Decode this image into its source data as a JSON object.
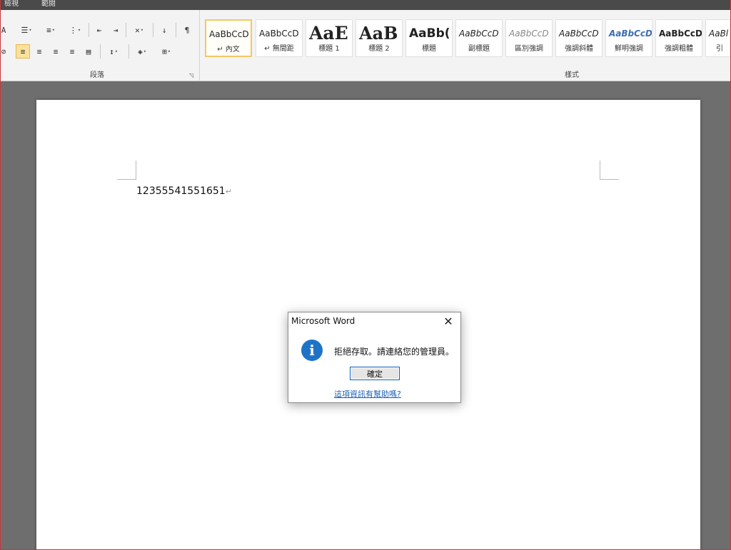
{
  "menu": {
    "items": [
      "檢視",
      "範閱"
    ]
  },
  "ribbon": {
    "paragraph_group_label": "段落",
    "styles_group_label": "樣式",
    "styles": [
      {
        "preview": "AaBbCcD",
        "name": "↵ 內文"
      },
      {
        "preview": "AaBbCcD",
        "name": "↵ 無間距"
      },
      {
        "preview": "AaE",
        "name": "標題 1"
      },
      {
        "preview": "AaB",
        "name": "標題 2"
      },
      {
        "preview": "AaBb(",
        "name": "標題"
      },
      {
        "preview": "AaBbCcD",
        "name": "副標題"
      },
      {
        "preview": "AaBbCcD",
        "name": "區別強調"
      },
      {
        "preview": "AaBbCcD",
        "name": "強調斜體"
      },
      {
        "preview": "AaBbCcD",
        "name": "鮮明強調"
      },
      {
        "preview": "AaBbCcD",
        "name": "強調粗體"
      },
      {
        "preview": "AaBl",
        "name": "引"
      }
    ],
    "accent_color": "#f3c863"
  },
  "document": {
    "text": "12355541551651",
    "paragraph_mark": "↵"
  },
  "dialog": {
    "title": "Microsoft Word",
    "icon": "info-icon",
    "message": "拒絕存取。請連絡您的管理員。",
    "ok_label": "確定",
    "help_link": "這項資訊有幫助嗎?",
    "icon_color": "#1e73c8"
  }
}
